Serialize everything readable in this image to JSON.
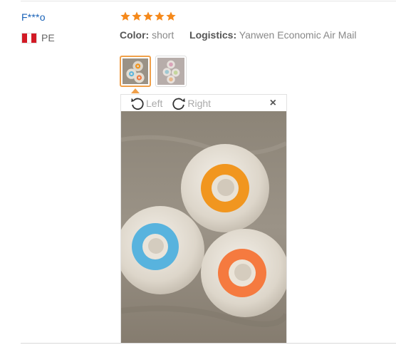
{
  "review": {
    "user_name": "F***o",
    "country_code": "PE",
    "rating": 5,
    "color_label": "Color:",
    "color_value": "short",
    "logistics_label": "Logistics:",
    "logistics_value": "Yanwen Economic Air Mail"
  },
  "viewer": {
    "rotate_left_label": "Left",
    "rotate_right_label": "Right",
    "close_symbol": "×"
  },
  "thumbnails": [
    {
      "name": "review-photo-1",
      "active": true
    },
    {
      "name": "review-photo-2",
      "active": false
    }
  ],
  "colors": {
    "user_link": "#1a63b8",
    "star": "#f5891b",
    "active_border": "#f0a04a"
  },
  "icons": [
    "star-icon",
    "rotate-left-icon",
    "rotate-right-icon",
    "close-icon",
    "peru-flag-icon"
  ]
}
